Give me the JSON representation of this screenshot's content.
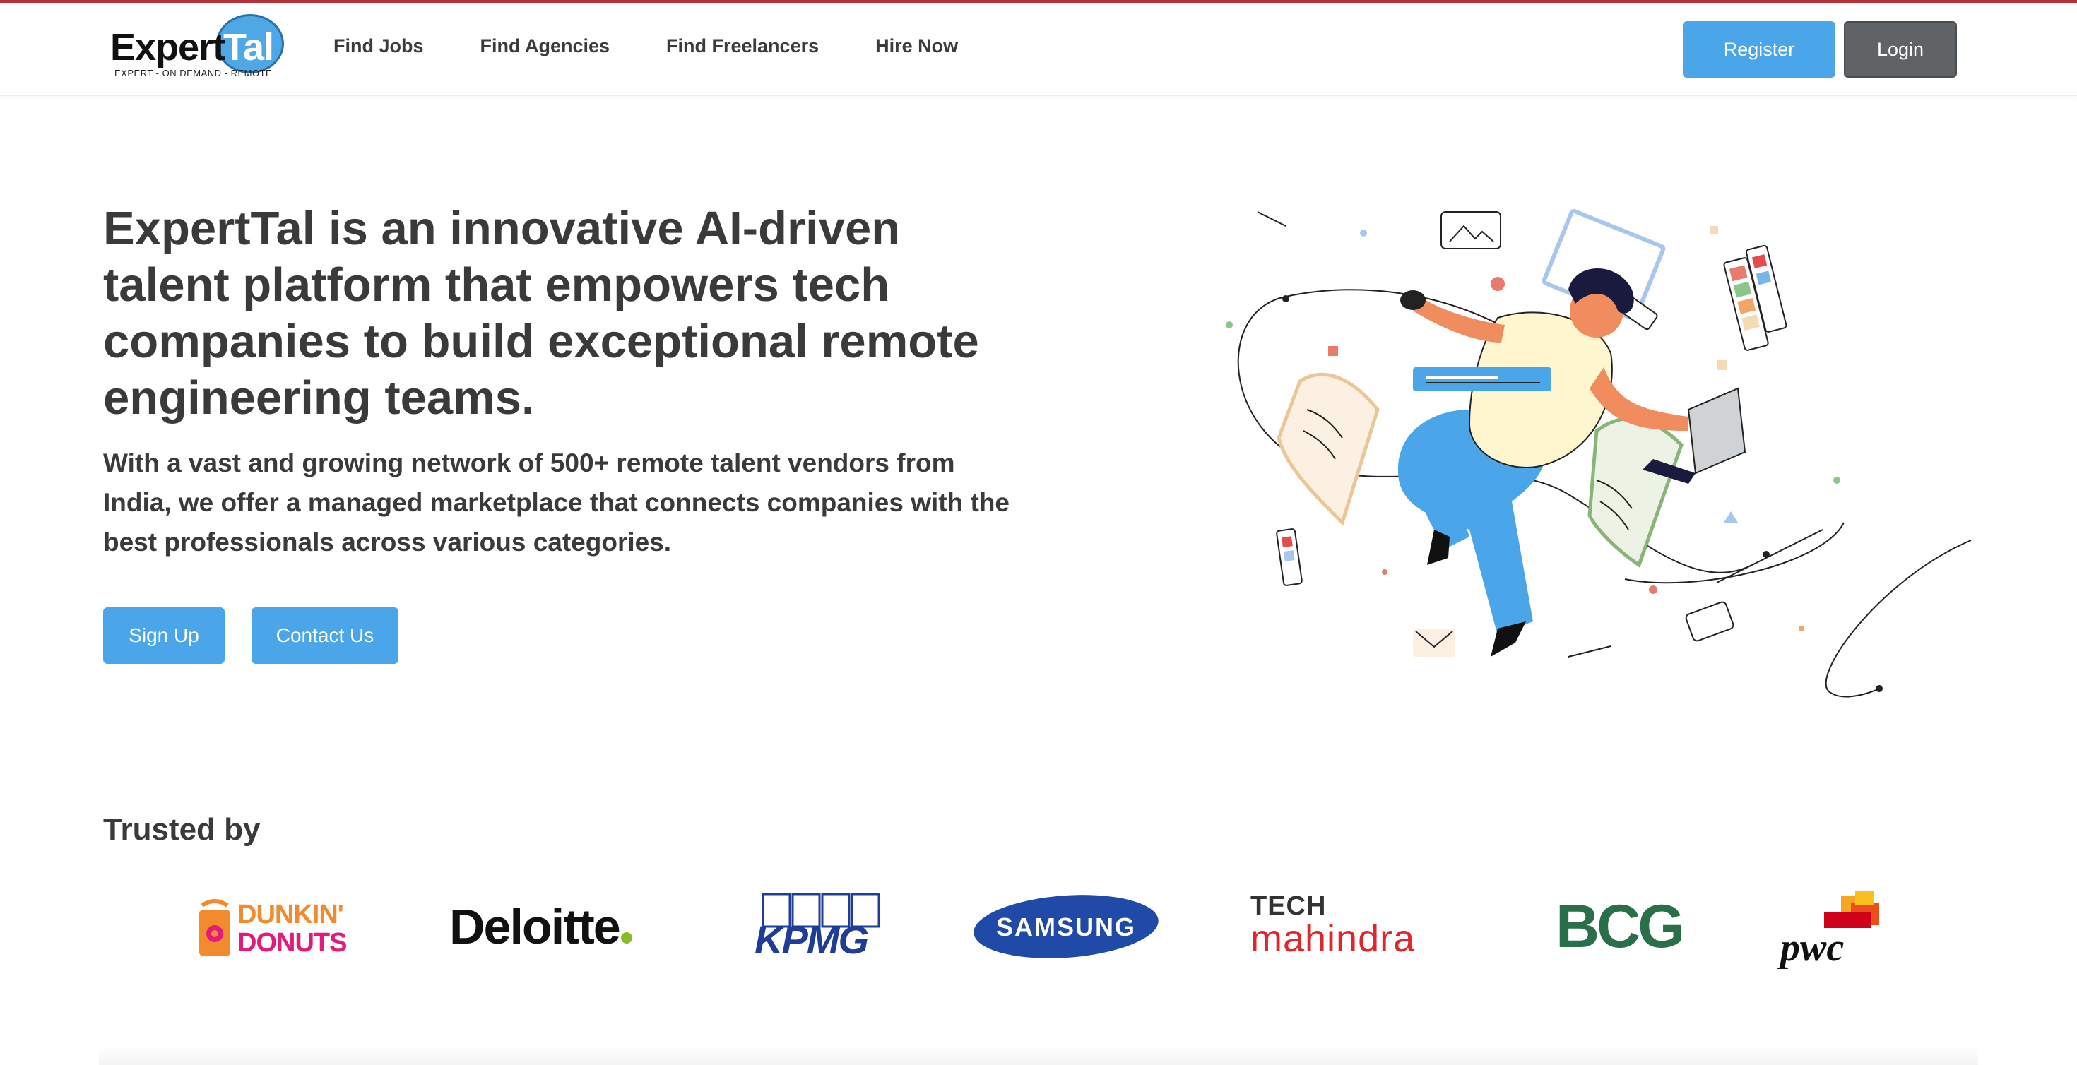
{
  "header": {
    "logo": {
      "word": "Expert",
      "accent": "Tal",
      "tagline": "EXPERT - ON DEMAND - REMOTE"
    },
    "nav": [
      {
        "label": "Find Jobs"
      },
      {
        "label": "Find Agencies"
      },
      {
        "label": "Find Freelancers"
      },
      {
        "label": "Hire Now"
      }
    ],
    "register_label": "Register",
    "login_label": "Login"
  },
  "hero": {
    "title": "ExpertTal is an innovative AI-driven talent platform that empowers tech companies to build exceptional remote engineering teams.",
    "subtitle": "With a vast and growing network of 500+ remote talent vendors from India, we offer a managed marketplace that connects companies with the best professionals across various categories.",
    "signup_label": "Sign Up",
    "contact_label": "Contact Us",
    "illustration": "person-floating-with-laptop-illustration"
  },
  "trusted": {
    "heading": "Trusted by",
    "logos": [
      {
        "name": "DUNKIN'",
        "line2": "DONUTS"
      },
      {
        "name": "Deloitte"
      },
      {
        "name": "KPMG"
      },
      {
        "name": "SAMSUNG"
      },
      {
        "name": "TECH",
        "line2": "mahindra"
      },
      {
        "name": "BCG"
      },
      {
        "name": "pwc"
      }
    ]
  },
  "colors": {
    "accent": "#4aa6e8",
    "login_bg": "#5f6366",
    "text": "#3a3a3a",
    "top_border": "#b5323a"
  }
}
